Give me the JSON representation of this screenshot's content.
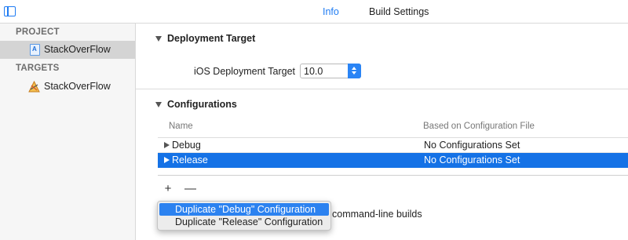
{
  "tabs": {
    "info": "Info",
    "build_settings": "Build Settings"
  },
  "sidebar": {
    "project_header": "PROJECT",
    "project_item": "StackOverFlow",
    "targets_header": "TARGETS",
    "target_item": "StackOverFlow"
  },
  "deployment": {
    "section_title": "Deployment Target",
    "label": "iOS Deployment Target",
    "value": "10.0"
  },
  "configurations": {
    "section_title": "Configurations",
    "columns": {
      "name": "Name",
      "based_on": "Based on Configuration File"
    },
    "rows": [
      {
        "name": "Debug",
        "based_on": "No Configurations Set"
      },
      {
        "name": "Release",
        "based_on": "No Configurations Set"
      }
    ],
    "add_label": "+",
    "remove_label": "—",
    "command_line_text": "command-line builds"
  },
  "menu": {
    "items": [
      "Duplicate \"Debug\" Configuration",
      "Duplicate \"Release\" Configuration"
    ]
  },
  "colors": {
    "accent": "#1f7cf3",
    "selection": "#1572e6"
  }
}
